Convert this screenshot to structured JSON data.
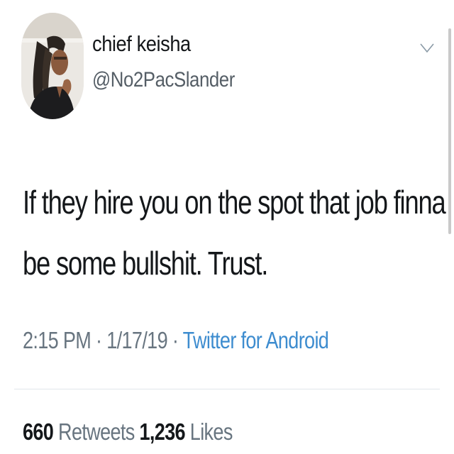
{
  "user": {
    "display_name": "chief keisha",
    "handle": "@No2PacSlander",
    "avatar_icon": "profile-photo"
  },
  "menu": {
    "icon": "chevron-down-icon"
  },
  "tweet": {
    "line1": "If they hire you on the spot that job finna",
    "line2": "be some bullshit. Trust."
  },
  "meta": {
    "time": "2:15 PM",
    "sep1": " · ",
    "date": "1/17/19",
    "sep2": " · ",
    "source": "Twitter for Android"
  },
  "stats": {
    "retweets_count": "660",
    "retweets_label": "Retweets",
    "likes_count": "1,236",
    "likes_label": "Likes"
  },
  "colors": {
    "text": "#14171a",
    "secondary": "#687580",
    "link": "#3d8ccf",
    "divider": "#e1e6ea"
  }
}
